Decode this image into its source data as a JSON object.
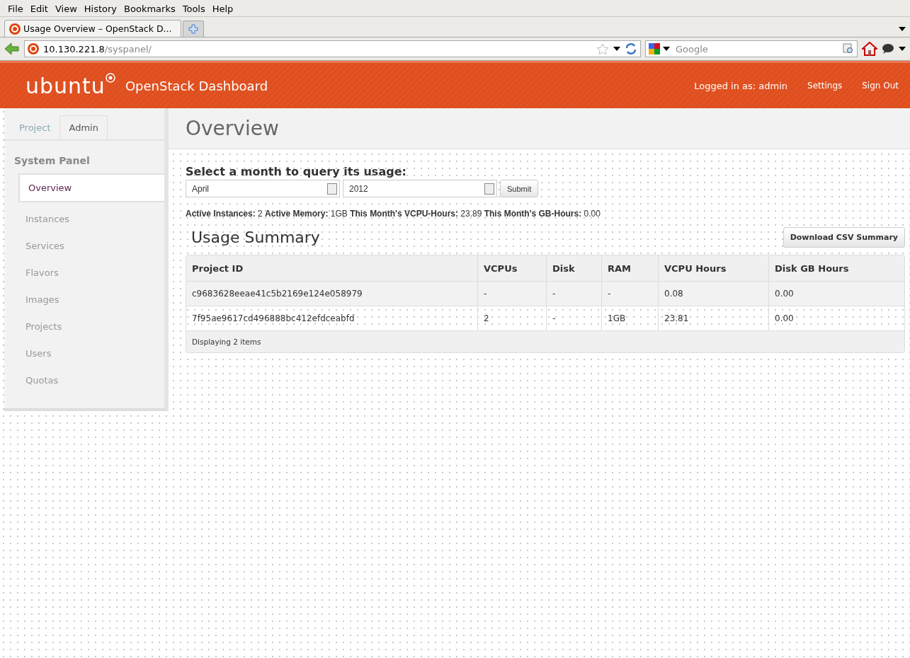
{
  "menu_bar": [
    "File",
    "Edit",
    "View",
    "History",
    "Bookmarks",
    "Tools",
    "Help"
  ],
  "browser_tabs": [
    {
      "title": "Usage Overview – OpenStack D...",
      "selected": true
    }
  ],
  "address_bar": {
    "host": "10.130.221.8",
    "path": "/syspanel/"
  },
  "search_box": {
    "placeholder": "Google"
  },
  "header": {
    "logo": "ubuntu",
    "product": "OpenStack Dashboard",
    "user": "Logged in as: admin",
    "links": [
      "Settings",
      "Sign Out"
    ]
  },
  "sidebar": {
    "tabs": [
      {
        "label": "Project",
        "selected": false
      },
      {
        "label": "Admin",
        "selected": true
      }
    ],
    "heading": "System Panel",
    "items": [
      {
        "label": "Overview",
        "selected": true
      },
      {
        "label": "Instances",
        "selected": false
      },
      {
        "label": "Services",
        "selected": false
      },
      {
        "label": "Flavors",
        "selected": false
      },
      {
        "label": "Images",
        "selected": false
      },
      {
        "label": "Projects",
        "selected": false
      },
      {
        "label": "Users",
        "selected": false
      },
      {
        "label": "Quotas",
        "selected": false
      }
    ]
  },
  "page_title": "Overview",
  "query": {
    "label": "Select a month to query its usage:",
    "month": "April",
    "year": "2012",
    "submit": "Submit"
  },
  "stats": "**Active Instances:** 2 **Active Memory:** 1GB **This Month's VCPU-Hours:** 23.89 **This Month's GB-Hours:** 0.00",
  "summary": {
    "title": "Usage Summary",
    "download": "Download CSV Summary",
    "columns": [
      "Project ID",
      "VCPUs",
      "Disk",
      "RAM",
      "VCPU Hours",
      "Disk GB Hours"
    ],
    "rows": [
      {
        "highlighted": true,
        "cells": [
          "c9683628eeae41c5b2169e124e058979",
          "-",
          "-",
          "-",
          "0.08",
          "0.00"
        ]
      },
      {
        "highlighted": false,
        "cells": [
          "7f95ae9617cd496888bc412efdceabfd",
          "2",
          "-",
          "1GB",
          "23.81",
          "0.00"
        ]
      }
    ],
    "footer": "Displaying 2 items"
  }
}
